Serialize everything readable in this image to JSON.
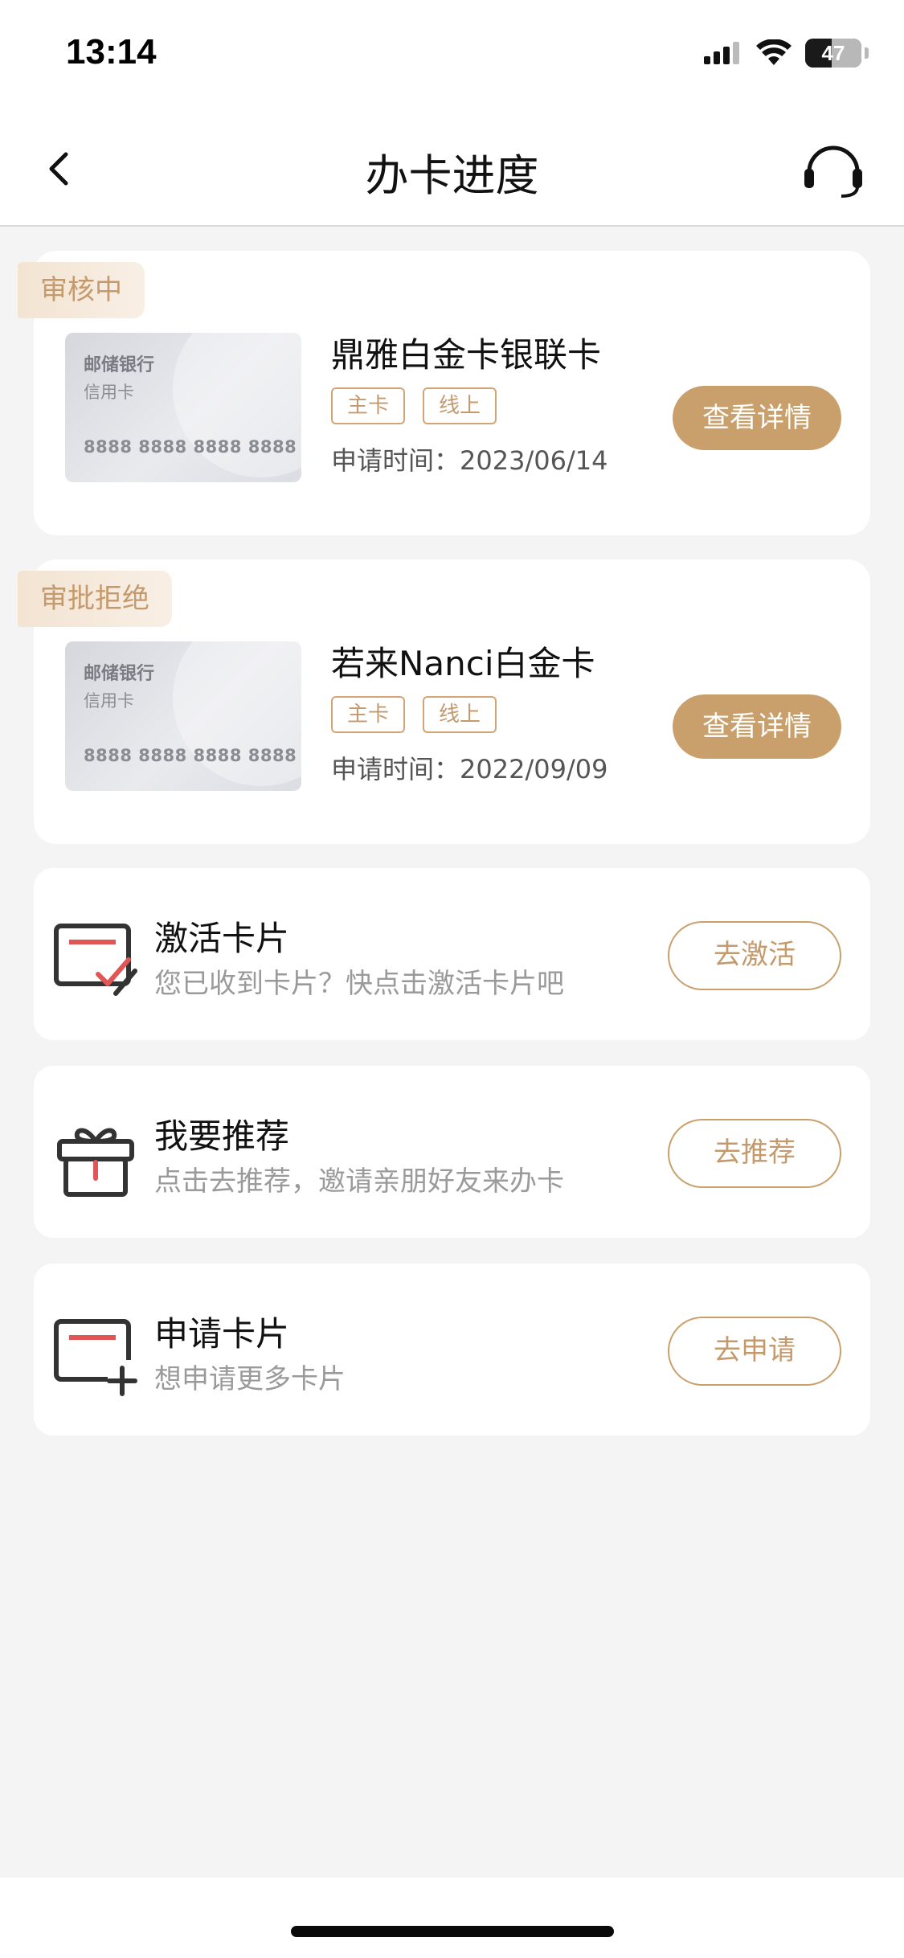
{
  "status_bar": {
    "time": "13:14",
    "battery": "47",
    "icons": [
      "signal-icon",
      "wifi-icon",
      "battery-icon"
    ]
  },
  "nav": {
    "title": "办卡进度",
    "icons": [
      "back-chevron-icon",
      "customer-service-icon"
    ]
  },
  "applications": [
    {
      "status": "审核中",
      "card_image": {
        "bank": "邮储银行",
        "type": "信用卡",
        "number": "8888 8888 8888 8888"
      },
      "name": "鼎雅白金卡银联卡",
      "tags": [
        "主卡",
        "线上"
      ],
      "date_text": "申请时间：2023/06/14",
      "button": "查看详情"
    },
    {
      "status": "审批拒绝",
      "card_image": {
        "bank": "邮储银行",
        "type": "信用卡",
        "number": "8888 8888 8888 8888"
      },
      "name": "若来Nanci白金卡",
      "tags": [
        "主卡",
        "线上"
      ],
      "date_text": "申请时间：2022/09/09",
      "button": "查看详情"
    }
  ],
  "actions": [
    {
      "icon": "activate-card-icon",
      "title": "激活卡片",
      "subtitle": "您已收到卡片？快点击激活卡片吧",
      "button": "去激活"
    },
    {
      "icon": "gift-icon",
      "title": "我要推荐",
      "subtitle": "点击去推荐，邀请亲朋好友来办卡",
      "button": "去推荐"
    },
    {
      "icon": "add-card-icon",
      "title": "申请卡片",
      "subtitle": "想申请更多卡片",
      "button": "去申请"
    }
  ],
  "colors": {
    "accent": "#c9a06b",
    "accent_text": "#c49a6c",
    "icon_red": "#e05555",
    "background": "#f4f4f4"
  }
}
